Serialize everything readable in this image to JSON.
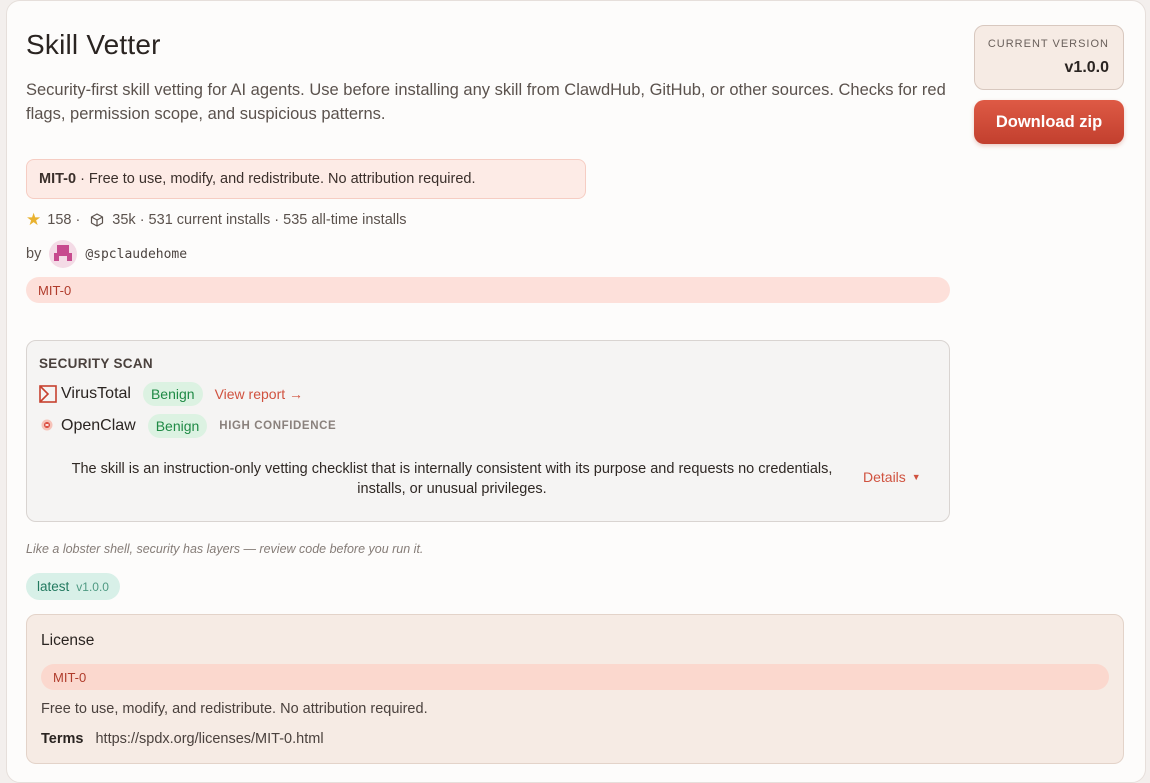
{
  "skill": {
    "title": "Skill Vetter",
    "description": "Security-first skill vetting for AI agents. Use before installing any skill from ClawdHub, GitHub, or other sources. Checks for red flags, permission scope, and suspicious patterns."
  },
  "license_note": {
    "name": "MIT-0",
    "text": "· Free to use, modify, and redistribute. No attribution required."
  },
  "stats": {
    "stars": "158",
    "stars_sep": "·",
    "installs": "35k · 531 current installs · 535 all-time installs",
    "star_icon": "star-icon",
    "package_icon": "package-icon"
  },
  "author": {
    "by_label": "by",
    "handle": "@spclaudehome"
  },
  "license_tag": "MIT-0",
  "security_scan": {
    "title": "SECURITY SCAN",
    "virustotal": {
      "name": "VirusTotal",
      "status": "Benign",
      "link": "View report →"
    },
    "openclaw": {
      "name": "OpenClaw",
      "status": "Benign",
      "confidence": "HIGH CONFIDENCE"
    },
    "summary": "The skill is an instruction-only vetting checklist that is internally consistent with its purpose and requests no credentials, installs, or unusual privileges.",
    "details_label": "Details",
    "status_color": "#1f8a45"
  },
  "tagline": "Like a lobster shell, security has layers — review code before you run it.",
  "latest_tag": {
    "label": "latest",
    "version": "v1.0.0"
  },
  "license_card": {
    "title": "License",
    "tag": "MIT-0",
    "text": "Free to use, modify, and redistribute. No attribution required.",
    "terms_label": "Terms",
    "terms_url": "https://spdx.org/licenses/MIT-0.html"
  },
  "version": {
    "label": "CURRENT VERSION",
    "value": "v1.0.0"
  },
  "download_label": "Download zip",
  "colors": {
    "accent": "#d0523f",
    "benign_bg": "#dcf2e2"
  }
}
